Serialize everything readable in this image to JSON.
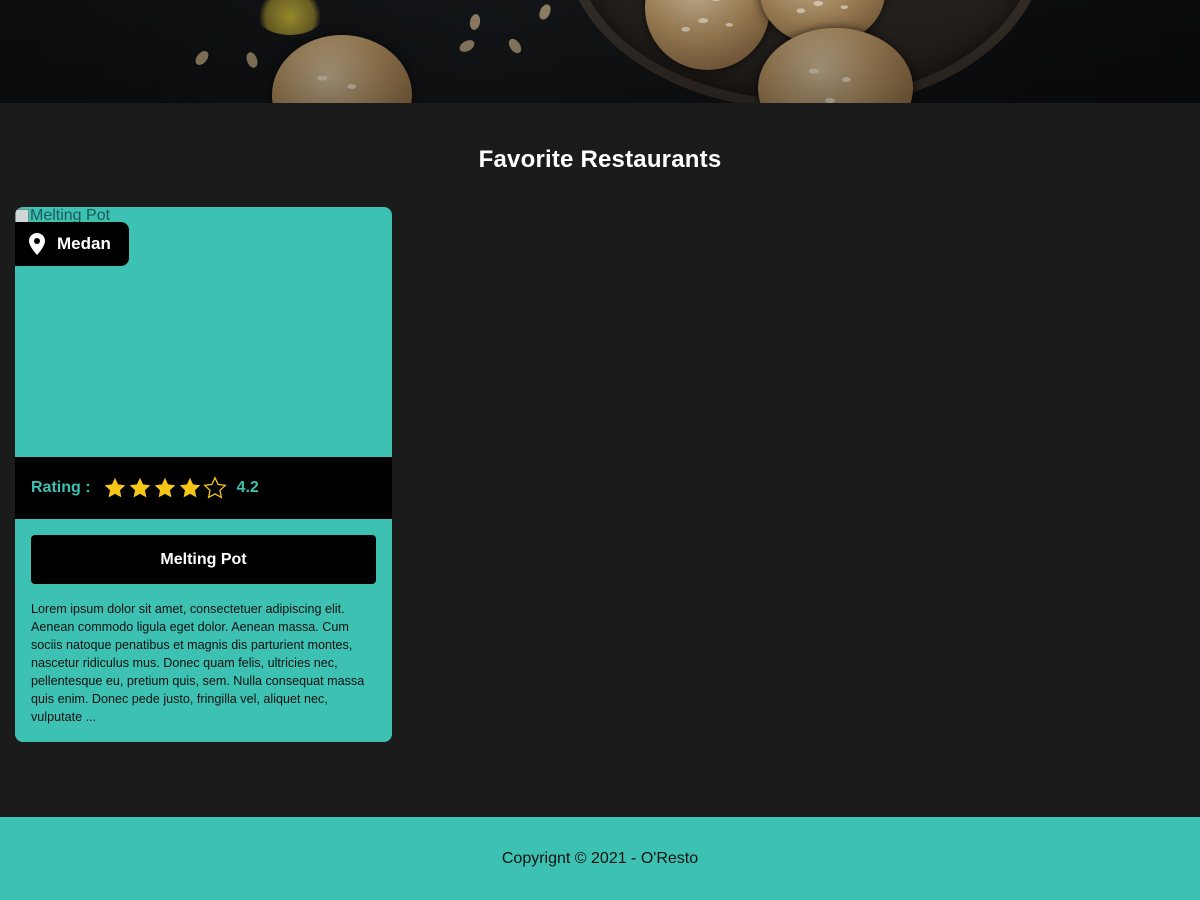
{
  "hero": {
    "image_alt": "Hero image of almond cookies"
  },
  "favorites": {
    "title": "Favorite Restaurants"
  },
  "restaurants": [
    {
      "name": "Melting Pot",
      "image_alt": "Melting Pot",
      "city": "Medan",
      "rating_label": "Rating :",
      "rating": "4.2",
      "rating_value": 4.2,
      "stars_filled": 4,
      "stars_total": 5,
      "description": "Lorem ipsum dolor sit amet, consectetuer adipiscing elit. Aenean commodo ligula eget dolor. Aenean massa. Cum sociis natoque penatibus et magnis dis parturient montes, nascetur ridiculus mus. Donec quam felis, ultricies nec, pellentesque eu, pretium quis, sem. Nulla consequat massa quis enim. Donec pede justo, fringilla vel, aliquet nec, vulputate ..."
    }
  ],
  "icons": {
    "city": "location-pin-icon",
    "star_filled": "star-filled-icon",
    "star_empty": "star-outline-icon"
  },
  "colors": {
    "accent": "#3dc1b3",
    "background": "#1b1b1b",
    "star": "#f5c518",
    "badge": "#000000"
  },
  "footer": {
    "copyright": "Copyrignt © 2021 - O'Resto"
  }
}
